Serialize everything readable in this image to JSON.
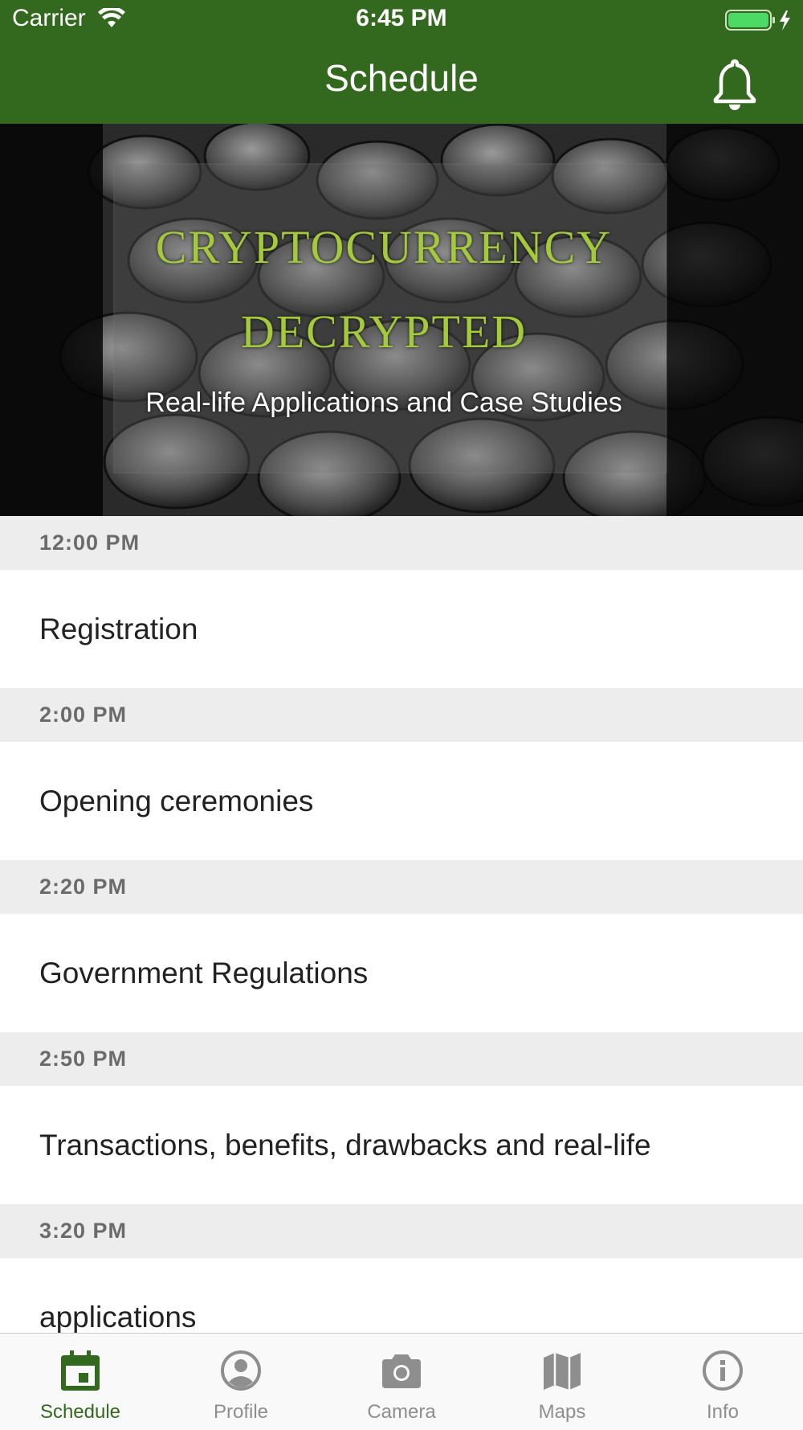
{
  "status_bar": {
    "carrier": "Carrier",
    "time": "6:45 PM"
  },
  "nav": {
    "title": "Schedule",
    "bell_icon": "bell-icon"
  },
  "banner": {
    "line1": "CRYPTOCURRENCY",
    "line2": "DECRYPTED",
    "subtitle": "Real-life Applications and Case Studies"
  },
  "schedule": [
    {
      "time": "12:00 PM",
      "title": "Registration"
    },
    {
      "time": "2:00 PM",
      "title": "Opening ceremonies"
    },
    {
      "time": "2:20 PM",
      "title": "Government Regulations"
    },
    {
      "time": "2:50 PM",
      "title": "Transactions, benefits, drawbacks and real-life"
    },
    {
      "time": "3:20 PM",
      "title": "applications"
    }
  ],
  "tabs": [
    {
      "label": "Schedule",
      "icon": "calendar-icon",
      "active": true
    },
    {
      "label": "Profile",
      "icon": "user-icon",
      "active": false
    },
    {
      "label": "Camera",
      "icon": "camera-icon",
      "active": false
    },
    {
      "label": "Maps",
      "icon": "map-icon",
      "active": false
    },
    {
      "label": "Info",
      "icon": "info-icon",
      "active": false
    }
  ],
  "colors": {
    "accent": "#33691e",
    "banner_text": "#a4c93a",
    "inactive_tab": "#8e8e8e"
  }
}
